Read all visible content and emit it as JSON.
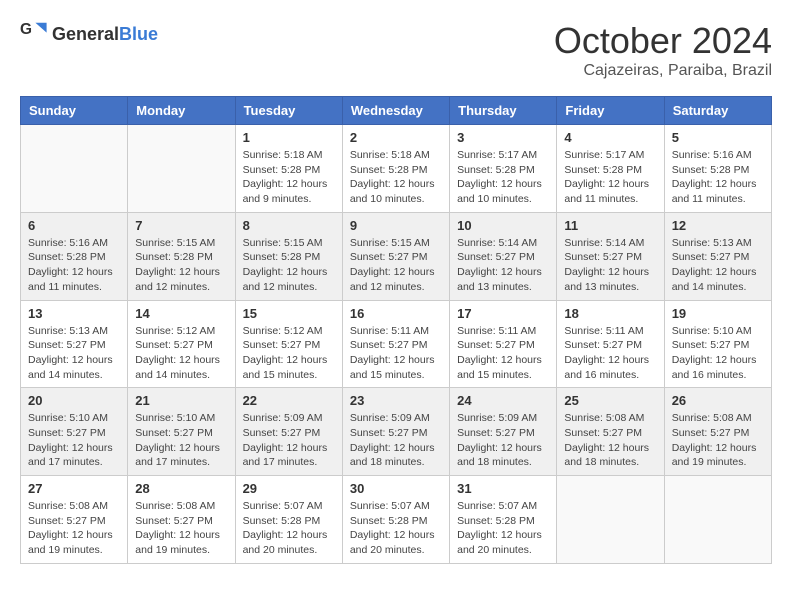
{
  "header": {
    "logo_general": "General",
    "logo_blue": "Blue",
    "month_title": "October 2024",
    "location": "Cajazeiras, Paraiba, Brazil"
  },
  "weekdays": [
    "Sunday",
    "Monday",
    "Tuesday",
    "Wednesday",
    "Thursday",
    "Friday",
    "Saturday"
  ],
  "weeks": [
    [
      {
        "day": "",
        "sunrise": "",
        "sunset": "",
        "daylight": "",
        "empty": true
      },
      {
        "day": "",
        "sunrise": "",
        "sunset": "",
        "daylight": "",
        "empty": true
      },
      {
        "day": "1",
        "sunrise": "Sunrise: 5:18 AM",
        "sunset": "Sunset: 5:28 PM",
        "daylight": "Daylight: 12 hours and 9 minutes.",
        "empty": false
      },
      {
        "day": "2",
        "sunrise": "Sunrise: 5:18 AM",
        "sunset": "Sunset: 5:28 PM",
        "daylight": "Daylight: 12 hours and 10 minutes.",
        "empty": false
      },
      {
        "day": "3",
        "sunrise": "Sunrise: 5:17 AM",
        "sunset": "Sunset: 5:28 PM",
        "daylight": "Daylight: 12 hours and 10 minutes.",
        "empty": false
      },
      {
        "day": "4",
        "sunrise": "Sunrise: 5:17 AM",
        "sunset": "Sunset: 5:28 PM",
        "daylight": "Daylight: 12 hours and 11 minutes.",
        "empty": false
      },
      {
        "day": "5",
        "sunrise": "Sunrise: 5:16 AM",
        "sunset": "Sunset: 5:28 PM",
        "daylight": "Daylight: 12 hours and 11 minutes.",
        "empty": false
      }
    ],
    [
      {
        "day": "6",
        "sunrise": "Sunrise: 5:16 AM",
        "sunset": "Sunset: 5:28 PM",
        "daylight": "Daylight: 12 hours and 11 minutes.",
        "empty": false
      },
      {
        "day": "7",
        "sunrise": "Sunrise: 5:15 AM",
        "sunset": "Sunset: 5:28 PM",
        "daylight": "Daylight: 12 hours and 12 minutes.",
        "empty": false
      },
      {
        "day": "8",
        "sunrise": "Sunrise: 5:15 AM",
        "sunset": "Sunset: 5:28 PM",
        "daylight": "Daylight: 12 hours and 12 minutes.",
        "empty": false
      },
      {
        "day": "9",
        "sunrise": "Sunrise: 5:15 AM",
        "sunset": "Sunset: 5:27 PM",
        "daylight": "Daylight: 12 hours and 12 minutes.",
        "empty": false
      },
      {
        "day": "10",
        "sunrise": "Sunrise: 5:14 AM",
        "sunset": "Sunset: 5:27 PM",
        "daylight": "Daylight: 12 hours and 13 minutes.",
        "empty": false
      },
      {
        "day": "11",
        "sunrise": "Sunrise: 5:14 AM",
        "sunset": "Sunset: 5:27 PM",
        "daylight": "Daylight: 12 hours and 13 minutes.",
        "empty": false
      },
      {
        "day": "12",
        "sunrise": "Sunrise: 5:13 AM",
        "sunset": "Sunset: 5:27 PM",
        "daylight": "Daylight: 12 hours and 14 minutes.",
        "empty": false
      }
    ],
    [
      {
        "day": "13",
        "sunrise": "Sunrise: 5:13 AM",
        "sunset": "Sunset: 5:27 PM",
        "daylight": "Daylight: 12 hours and 14 minutes.",
        "empty": false
      },
      {
        "day": "14",
        "sunrise": "Sunrise: 5:12 AM",
        "sunset": "Sunset: 5:27 PM",
        "daylight": "Daylight: 12 hours and 14 minutes.",
        "empty": false
      },
      {
        "day": "15",
        "sunrise": "Sunrise: 5:12 AM",
        "sunset": "Sunset: 5:27 PM",
        "daylight": "Daylight: 12 hours and 15 minutes.",
        "empty": false
      },
      {
        "day": "16",
        "sunrise": "Sunrise: 5:11 AM",
        "sunset": "Sunset: 5:27 PM",
        "daylight": "Daylight: 12 hours and 15 minutes.",
        "empty": false
      },
      {
        "day": "17",
        "sunrise": "Sunrise: 5:11 AM",
        "sunset": "Sunset: 5:27 PM",
        "daylight": "Daylight: 12 hours and 15 minutes.",
        "empty": false
      },
      {
        "day": "18",
        "sunrise": "Sunrise: 5:11 AM",
        "sunset": "Sunset: 5:27 PM",
        "daylight": "Daylight: 12 hours and 16 minutes.",
        "empty": false
      },
      {
        "day": "19",
        "sunrise": "Sunrise: 5:10 AM",
        "sunset": "Sunset: 5:27 PM",
        "daylight": "Daylight: 12 hours and 16 minutes.",
        "empty": false
      }
    ],
    [
      {
        "day": "20",
        "sunrise": "Sunrise: 5:10 AM",
        "sunset": "Sunset: 5:27 PM",
        "daylight": "Daylight: 12 hours and 17 minutes.",
        "empty": false
      },
      {
        "day": "21",
        "sunrise": "Sunrise: 5:10 AM",
        "sunset": "Sunset: 5:27 PM",
        "daylight": "Daylight: 12 hours and 17 minutes.",
        "empty": false
      },
      {
        "day": "22",
        "sunrise": "Sunrise: 5:09 AM",
        "sunset": "Sunset: 5:27 PM",
        "daylight": "Daylight: 12 hours and 17 minutes.",
        "empty": false
      },
      {
        "day": "23",
        "sunrise": "Sunrise: 5:09 AM",
        "sunset": "Sunset: 5:27 PM",
        "daylight": "Daylight: 12 hours and 18 minutes.",
        "empty": false
      },
      {
        "day": "24",
        "sunrise": "Sunrise: 5:09 AM",
        "sunset": "Sunset: 5:27 PM",
        "daylight": "Daylight: 12 hours and 18 minutes.",
        "empty": false
      },
      {
        "day": "25",
        "sunrise": "Sunrise: 5:08 AM",
        "sunset": "Sunset: 5:27 PM",
        "daylight": "Daylight: 12 hours and 18 minutes.",
        "empty": false
      },
      {
        "day": "26",
        "sunrise": "Sunrise: 5:08 AM",
        "sunset": "Sunset: 5:27 PM",
        "daylight": "Daylight: 12 hours and 19 minutes.",
        "empty": false
      }
    ],
    [
      {
        "day": "27",
        "sunrise": "Sunrise: 5:08 AM",
        "sunset": "Sunset: 5:27 PM",
        "daylight": "Daylight: 12 hours and 19 minutes.",
        "empty": false
      },
      {
        "day": "28",
        "sunrise": "Sunrise: 5:08 AM",
        "sunset": "Sunset: 5:27 PM",
        "daylight": "Daylight: 12 hours and 19 minutes.",
        "empty": false
      },
      {
        "day": "29",
        "sunrise": "Sunrise: 5:07 AM",
        "sunset": "Sunset: 5:28 PM",
        "daylight": "Daylight: 12 hours and 20 minutes.",
        "empty": false
      },
      {
        "day": "30",
        "sunrise": "Sunrise: 5:07 AM",
        "sunset": "Sunset: 5:28 PM",
        "daylight": "Daylight: 12 hours and 20 minutes.",
        "empty": false
      },
      {
        "day": "31",
        "sunrise": "Sunrise: 5:07 AM",
        "sunset": "Sunset: 5:28 PM",
        "daylight": "Daylight: 12 hours and 20 minutes.",
        "empty": false
      },
      {
        "day": "",
        "sunrise": "",
        "sunset": "",
        "daylight": "",
        "empty": true
      },
      {
        "day": "",
        "sunrise": "",
        "sunset": "",
        "daylight": "",
        "empty": true
      }
    ]
  ]
}
